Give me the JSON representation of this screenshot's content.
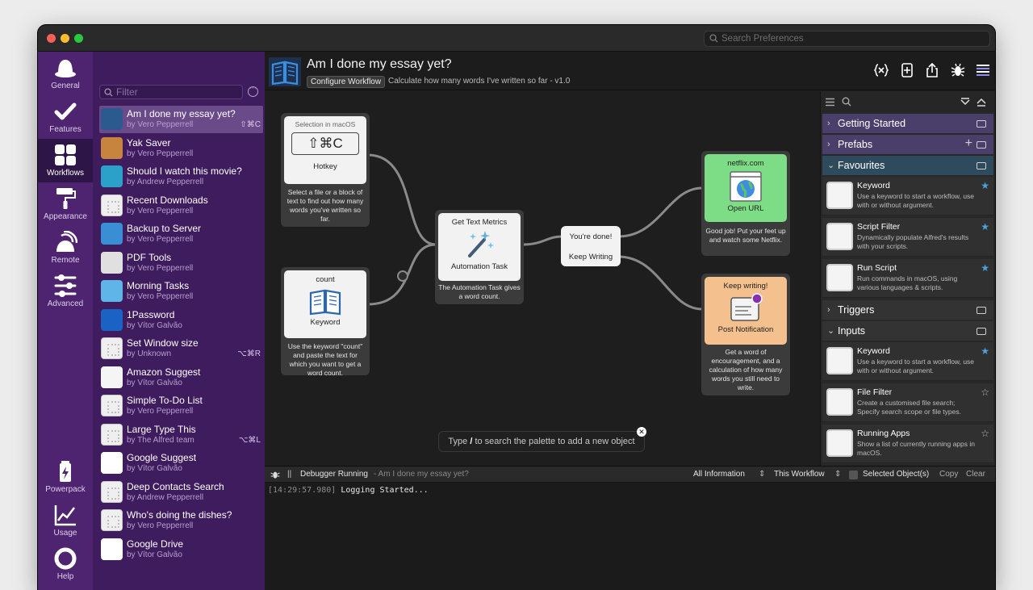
{
  "titlebar": {
    "search_placeholder": "Search Preferences"
  },
  "nav": {
    "items": [
      {
        "label": "General",
        "icon": "hat-icon"
      },
      {
        "label": "Features",
        "icon": "checkmark-icon"
      },
      {
        "label": "Workflows",
        "icon": "grid-icon"
      },
      {
        "label": "Appearance",
        "icon": "paint-roller-icon"
      },
      {
        "label": "Remote",
        "icon": "remote-icon"
      },
      {
        "label": "Advanced",
        "icon": "sliders-icon"
      },
      {
        "label": "Powerpack",
        "icon": "battery-icon"
      },
      {
        "label": "Usage",
        "icon": "chart-icon"
      },
      {
        "label": "Help",
        "icon": "lifebuoy-icon"
      }
    ]
  },
  "workflows": {
    "filter_placeholder": "Filter",
    "items": [
      {
        "name": "Am I done my essay yet?",
        "author": "by Vero Pepperrell",
        "hotkey": "⇧⌘C",
        "color": "#2b5a8e"
      },
      {
        "name": "Yak Saver",
        "author": "by Vero Pepperrell",
        "hotkey": "",
        "color": "#c6843e"
      },
      {
        "name": "Should I watch this movie?",
        "author": "by Andrew Pepperrell",
        "hotkey": "",
        "color": "#2ba0c8"
      },
      {
        "name": "Recent Downloads",
        "author": "by Vero Pepperrell",
        "hotkey": "",
        "color": ""
      },
      {
        "name": "Backup to Server",
        "author": "by Vero Pepperrell",
        "hotkey": "",
        "color": "#3a8fd4"
      },
      {
        "name": "PDF Tools",
        "author": "by Vero Pepperrell",
        "hotkey": "",
        "color": "#e0e0e0"
      },
      {
        "name": "Morning Tasks",
        "author": "by Vero Pepperrell",
        "hotkey": "",
        "color": "#5fb4e8"
      },
      {
        "name": "1Password",
        "author": "by Vítor Galvão",
        "hotkey": "",
        "color": "#1a62c4"
      },
      {
        "name": "Set Window size",
        "author": "by Unknown",
        "hotkey": "⌥⌘R",
        "color": ""
      },
      {
        "name": "Amazon Suggest",
        "author": "by Vítor Galvão",
        "hotkey": "",
        "color": "#f5f5f5"
      },
      {
        "name": "Simple To-Do List",
        "author": "by Vero Pepperrell",
        "hotkey": "",
        "color": ""
      },
      {
        "name": "Large Type This",
        "author": "by The Alfred team",
        "hotkey": "⌥⌘L",
        "color": ""
      },
      {
        "name": "Google Suggest",
        "author": "by Vítor Galvão",
        "hotkey": "",
        "color": "#ffffff"
      },
      {
        "name": "Deep Contacts Search",
        "author": "by Andrew Pepperrell",
        "hotkey": "",
        "color": ""
      },
      {
        "name": "Who's doing the dishes?",
        "author": "by Vero Pepperrell",
        "hotkey": "",
        "color": ""
      },
      {
        "name": "Google Drive",
        "author": "by Vítor Galvão",
        "hotkey": "",
        "color": "#ffffff"
      }
    ]
  },
  "header": {
    "title": "Am I done my essay yet?",
    "configure_label": "Configure Workflow",
    "subtitle": "Calculate how many words I've written so far - v1.0"
  },
  "canvas": {
    "hotkey_node": {
      "top": "Selection in macOS",
      "keys": "⇧⌘C",
      "label": "Hotkey",
      "desc": "Select a file or a block of text to find out how many words you've written so far."
    },
    "keyword_node": {
      "top": "count",
      "label": "Keyword",
      "desc": "Use the keyword \"count\" and paste the text for which you want to get a word count."
    },
    "task_node": {
      "top": "Get Text Metrics",
      "label": "Automation Task",
      "desc": "The Automation Task gives a word count."
    },
    "condition_node": {
      "line1": "You're done!",
      "line2": "Keep Writing"
    },
    "url_node": {
      "top": "netflix.com",
      "label": "Open URL",
      "desc": "Good job! Put your feet up and watch some Netflix."
    },
    "notif_node": {
      "top": "Keep writing!",
      "label": "Post Notification",
      "desc": "Get a word of encouragement, and a calculation of how many words you still need to write."
    },
    "toast_pre": "Type",
    "toast_key": "/",
    "toast_post": "to search the palette to add a new object"
  },
  "palette": {
    "sections": {
      "getting_started": "Getting Started",
      "prefabs": "Prefabs",
      "favourites": "Favourites",
      "triggers": "Triggers",
      "inputs": "Inputs"
    },
    "favourites": [
      {
        "title": "Keyword",
        "desc": "Use a keyword to start a workflow, use with or without argument.",
        "starred": true
      },
      {
        "title": "Script Filter",
        "desc": "Dynamically populate Alfred's results with your scripts.",
        "starred": true
      },
      {
        "title": "Run Script",
        "desc": "Run commands in macOS, using various languages & scripts.",
        "starred": true
      }
    ],
    "inputs": [
      {
        "title": "Keyword",
        "desc": "Use a keyword to start a workflow, use with or without argument.",
        "starred": true
      },
      {
        "title": "File Filter",
        "desc": "Create a customised file search; Specify search scope or file types.",
        "starred": false
      },
      {
        "title": "Running Apps",
        "desc": "Show a list of currently running apps in macOS.",
        "starred": false
      }
    ]
  },
  "debugger": {
    "status": "Debugger Running",
    "context": "- Am I done my essay yet?",
    "filter_info": "All Information",
    "filter_scope": "This Workflow",
    "selected_label": "Selected Object(s)",
    "copy_label": "Copy",
    "clear_label": "Clear",
    "log_time": "[14:29:57.980]",
    "log_text": "Logging Started..."
  },
  "colors": {
    "sidebar": "#4e2470",
    "list": "#3f1c5e",
    "accent": "#5a4a8a",
    "fav_star": "#4aa3df",
    "url_node": "#7ddc86",
    "notif_node": "#f4c08e"
  }
}
